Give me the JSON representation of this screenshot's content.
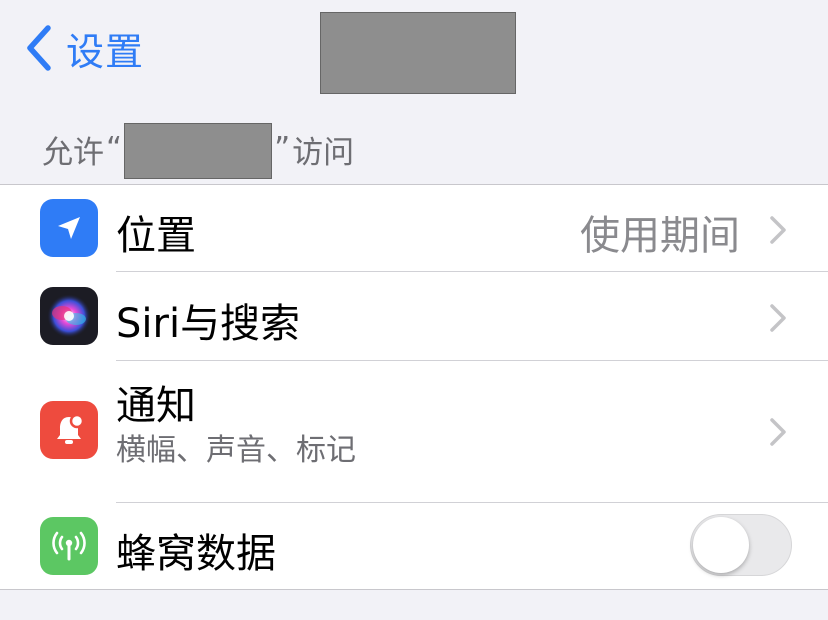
{
  "navbar": {
    "back_label": "设置",
    "title": ""
  },
  "section": {
    "prefix": "允许",
    "open_quote": "“",
    "close_quote": "”",
    "suffix": "访问"
  },
  "rows": [
    {
      "title": "位置",
      "value": "使用期间",
      "icon": "location-arrow-icon",
      "icon_color": "#2f7cf6"
    },
    {
      "title": "Siri与搜索",
      "icon": "siri-icon",
      "icon_color": "#1c1c24"
    },
    {
      "title": "通知",
      "subtitle": "横幅、声音、标记",
      "icon": "notification-bell-icon",
      "icon_color": "#ee4b3e"
    },
    {
      "title": "蜂窝数据",
      "icon": "cellular-antenna-icon",
      "icon_color": "#5cc763",
      "toggle_on": false
    }
  ],
  "colors": {
    "accent": "#2f7cf6",
    "background": "#f2f2f7"
  }
}
